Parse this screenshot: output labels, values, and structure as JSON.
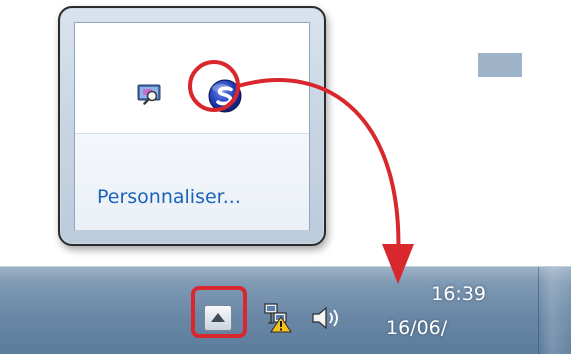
{
  "popup": {
    "customize_label": "Personnaliser..."
  },
  "tray_icons": [
    {
      "icon": "display-magnifier-icon"
    },
    {
      "icon": "scansnap-manager-icon"
    }
  ],
  "taskbar": {
    "show_hidden_icons": {
      "icon": "caret-up-icon"
    },
    "network_icon": "network-warning-icon",
    "volume_icon": "speaker-icon",
    "clock": {
      "time": "16:39",
      "date": "16/06/"
    }
  },
  "colors": {
    "highlight": "#d9272e",
    "link": "#1a63b8",
    "taskbar": "#6a88a6"
  }
}
